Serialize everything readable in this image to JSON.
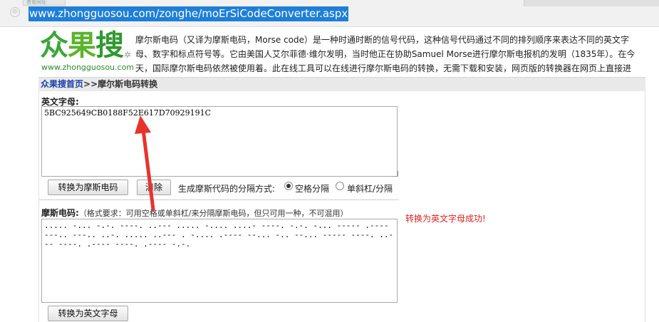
{
  "browser": {
    "url": "www.zhongguosou.com/zonghe/moErSiCodeConverter.aspx",
    "tab_hint": "查看网址"
  },
  "header": {
    "logo_text": [
      "众",
      "果",
      "搜"
    ],
    "logo_sub": "www.zhongguosou.com",
    "intro": "摩尔斯电码（又译为摩斯电码，Morse code）是一种时通时断的信号代码，这种信号代码通过不同的排列顺序来表达不同的英文字母、数字和标点符号等。它由美国人艾尔菲德·维尔发明，当时他正在协助Samuel Morse进行摩尔斯电报机的发明（1835年）。在今天，国际摩尔斯电码依然被使用着。此在线工具可以在线进行摩尔斯电码的转换，无需下载和安装，网页版的转换器在网页上直接进行。"
  },
  "breadcrumb": {
    "home": "众果搜首页",
    "sep": ">>",
    "current": "摩尔斯电码转换"
  },
  "converter": {
    "english_label": "英文字母:",
    "english_value": "5BC925649CB0188F52E617D70929191C",
    "to_morse_button": "转换为摩斯电码",
    "clear_button": "清除",
    "separator_label": "生成摩斯代码的分隔方式:",
    "separator_options": [
      {
        "label": "空格分隔",
        "checked": true
      },
      {
        "label": "单斜杠/分隔",
        "checked": false
      }
    ],
    "morse_label": "摩斯电码:",
    "morse_note": "（格式要求：可用空格或单斜杠/来分隔摩斯电码，但只可用一种，不可混用）",
    "morse_value": "..... -... -.-. ----. ..--- ..... -.... ....- ----. -.-. -... ----- .---- ---.. ---.. ..-. ..... ..--- . -.... .---- --... -.. --... ----- ----. ..--- ----. .---- ----. .---- -.-.",
    "to_english_button": "转换为英文字母",
    "status": "转换为英文字母成功!"
  },
  "colors": {
    "url_highlight": "#1e7fd8",
    "link": "#1a3fa8",
    "status": "#e02020",
    "arrow": "#e8322c",
    "logo_green": "#3ca63a"
  }
}
